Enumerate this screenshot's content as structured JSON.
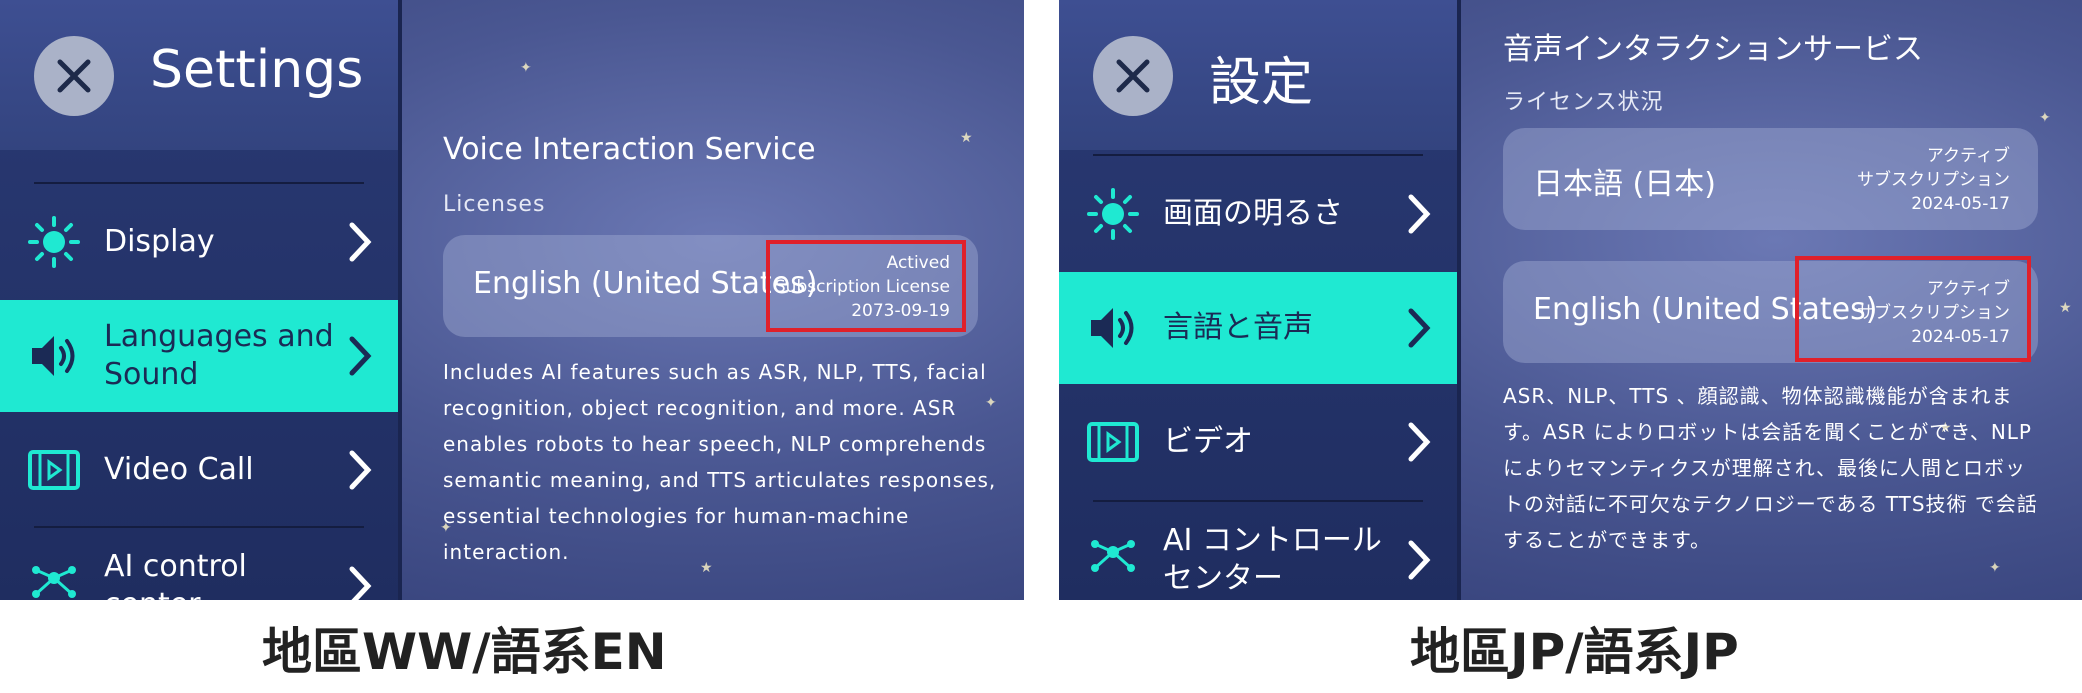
{
  "left": {
    "settings_title": "Settings",
    "menu": [
      {
        "label": "Display",
        "icon": "sun-icon"
      },
      {
        "label": "Languages and Sound",
        "icon": "speaker-icon",
        "active": true
      },
      {
        "label": "Video Call",
        "icon": "video-icon"
      },
      {
        "label": "AI control center",
        "icon": "ai-network-icon"
      }
    ],
    "service_title": "Voice Interaction Service",
    "licenses_label": "Licenses",
    "license": {
      "language": "English (United States)",
      "status_line1": "Actived",
      "status_line2": "Subscription License",
      "date": "2073-09-19"
    },
    "description": "Includes AI features such as ASR, NLP, TTS, facial recognition, object recognition, and more. ASR enables robots to hear speech, NLP comprehends semantic meaning, and TTS articulates responses, essential technologies for human-machine interaction.",
    "caption": "地區WW/語系EN"
  },
  "right": {
    "settings_title": "設定",
    "menu": [
      {
        "label": "画面の明るさ",
        "icon": "sun-icon"
      },
      {
        "label": "言語と音声",
        "icon": "speaker-icon",
        "active": true
      },
      {
        "label": "ビデオ",
        "icon": "video-icon"
      },
      {
        "label": "AI コントロール センター",
        "icon": "ai-network-icon"
      }
    ],
    "service_title": "音声インタラクションサービス",
    "licenses_label": "ライセンス状況",
    "license1": {
      "language": "日本語 (日本)",
      "status_line1": "アクティブ",
      "status_line2": "サブスクリプション",
      "date": "2024-05-17"
    },
    "license2": {
      "language": "English (United States)",
      "status_line1": "アクティブ",
      "status_line2": "サブスクリプション",
      "date": "2024-05-17"
    },
    "description": "ASR、NLP、TTS 、顔認識、物体認識機能が含まれます。ASR によりロボットは会話を聞くことができ、NLP によりセマンティクスが理解され、最後に人間とロボットの対話に不可欠なテクノロジーである TTS技術 で会話することができます。",
    "caption": "地區JP/語系JP"
  },
  "colors": {
    "accent": "#1fe9d2",
    "highlight": "#e0202a",
    "sidebar": "#1f2d60"
  }
}
